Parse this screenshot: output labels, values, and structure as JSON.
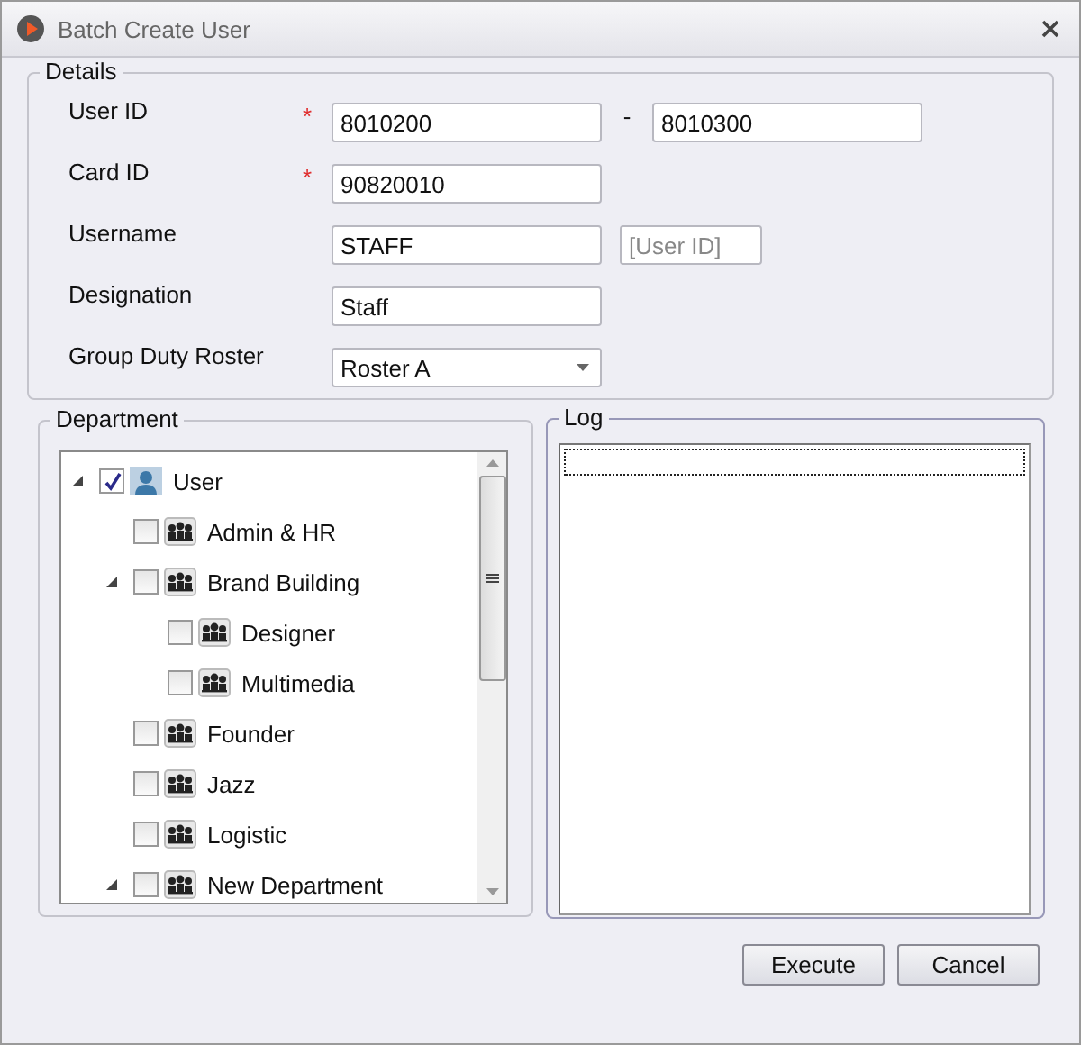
{
  "window": {
    "title": "Batch Create User"
  },
  "details": {
    "title": "Details",
    "fields": [
      {
        "label": "User ID",
        "required_mark": "*",
        "inputs": [
          {
            "value": "8010200"
          },
          {
            "value": "8010300"
          }
        ],
        "separator": "-"
      },
      {
        "label": "Card ID",
        "required_mark": "*",
        "inputs": [
          {
            "value": "90820010"
          }
        ]
      },
      {
        "label": "Username",
        "inputs": [
          {
            "value": "STAFF"
          },
          {
            "placeholder": "[User ID]"
          }
        ]
      },
      {
        "label": "Designation",
        "inputs": [
          {
            "value": "Staff"
          }
        ]
      },
      {
        "label": "Group Duty Roster",
        "kind": "dropdown",
        "inputs": [
          {
            "value": "Roster A"
          }
        ]
      }
    ]
  },
  "department": {
    "title": "Department",
    "tree": [
      {
        "label": "User",
        "kind": "user",
        "checked": true,
        "expanded": true,
        "children": [
          {
            "label": "Admin & HR",
            "kind": "group",
            "checked": false
          },
          {
            "label": "Brand Building",
            "kind": "group",
            "checked": false,
            "expanded": true,
            "children": [
              {
                "label": "Designer",
                "kind": "group",
                "checked": false
              },
              {
                "label": "Multimedia",
                "kind": "group",
                "checked": false
              }
            ]
          },
          {
            "label": "Founder",
            "kind": "group",
            "checked": false
          },
          {
            "label": "Jazz",
            "kind": "group",
            "checked": false
          },
          {
            "label": "Logistic",
            "kind": "group",
            "checked": false
          },
          {
            "label": "New Department",
            "kind": "group",
            "checked": false,
            "expanded": true
          }
        ]
      }
    ]
  },
  "log": {
    "title": "Log"
  },
  "buttons": [
    "Execute",
    "Cancel"
  ]
}
